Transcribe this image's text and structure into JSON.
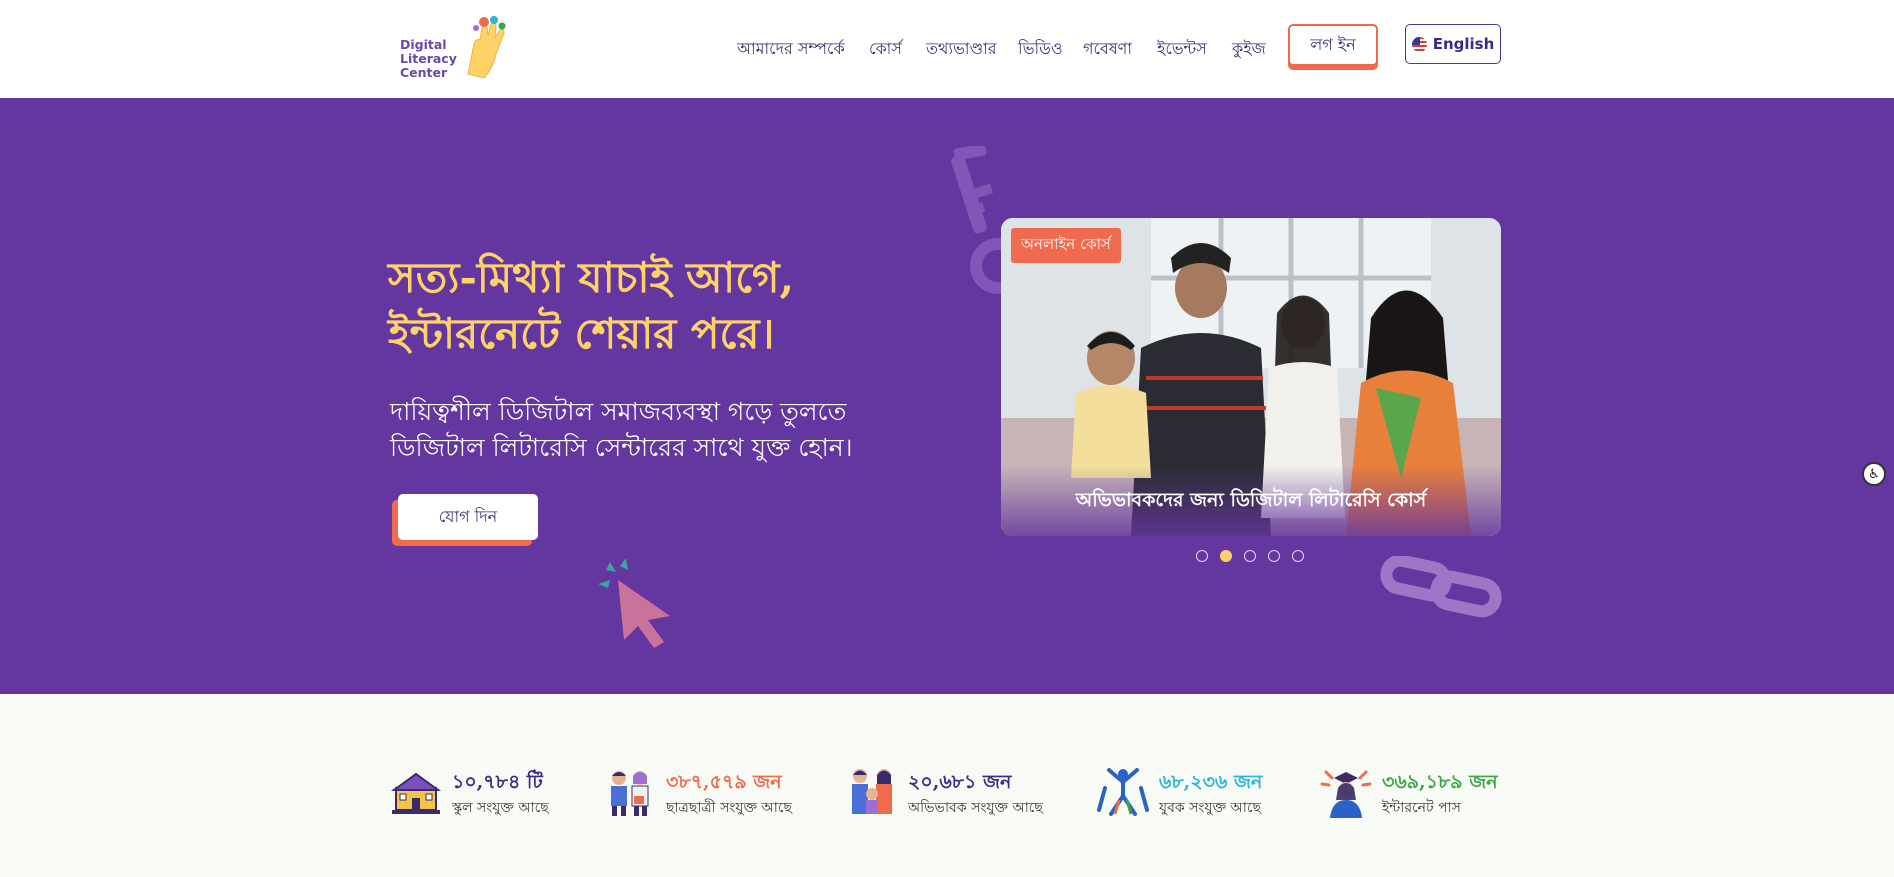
{
  "brand": {
    "logo_text": "Digital\nLiteracy\nCenter"
  },
  "nav": {
    "items": [
      "আমাদের সম্পর্কে",
      "কোর্স",
      "তথ্যভাণ্ডার",
      "ভিডিও",
      "গবেষণা",
      "ইভেন্টস",
      "কুইজ"
    ],
    "login_label": "লগ ইন",
    "language_label": "English"
  },
  "hero": {
    "title_line1": "সত্য-মিথ্যা যাচাই আগে,",
    "title_line2": "ইন্টারনেটে শেয়ার পরে।",
    "subtitle_line1": "দায়িত্বশীল ডিজিটাল সমাজব্যবস্থা গড়ে তুলতে",
    "subtitle_line2": "ডিজিটাল লিটারেসি সেন্টারের সাথে যুক্ত হোন।",
    "join_label": "যোগ দিন"
  },
  "slider": {
    "badge": "অনলাইন কোর্স",
    "caption": "অভিভাবকদের জন্য ডিজিটাল লিটারেসি কোর্স",
    "slide_count": 5,
    "active_index": 1
  },
  "stats": [
    {
      "number": "১০,৭৮৪ টি",
      "label": "স্কুল সংযুক্ত আছে",
      "color": "#3a2b8b",
      "icon": "school-icon"
    },
    {
      "number": "৩৮৭,৫৭৯ জন",
      "label": "ছাত্রছাত্রী সংযুক্ত আছে",
      "color": "#f06a4e",
      "icon": "students-icon"
    },
    {
      "number": "২০,৬৮১ জন",
      "label": "অভিভাবক সংযুক্ত আছে",
      "color": "#3a2b8b",
      "icon": "parents-icon"
    },
    {
      "number": "৬৮,২৩৬ জন",
      "label": "যুবক সংযুক্ত আছে",
      "color": "#2ab5d6",
      "icon": "youth-icon"
    },
    {
      "number": "৩৬৯,১৮৯ জন",
      "label": "ইন্টারনেট পাস",
      "color": "#3aa64a",
      "icon": "graduate-icon"
    }
  ],
  "colors": {
    "hero_bg": "#64369f",
    "accent": "#f06a4e",
    "highlight": "#ffd268"
  }
}
